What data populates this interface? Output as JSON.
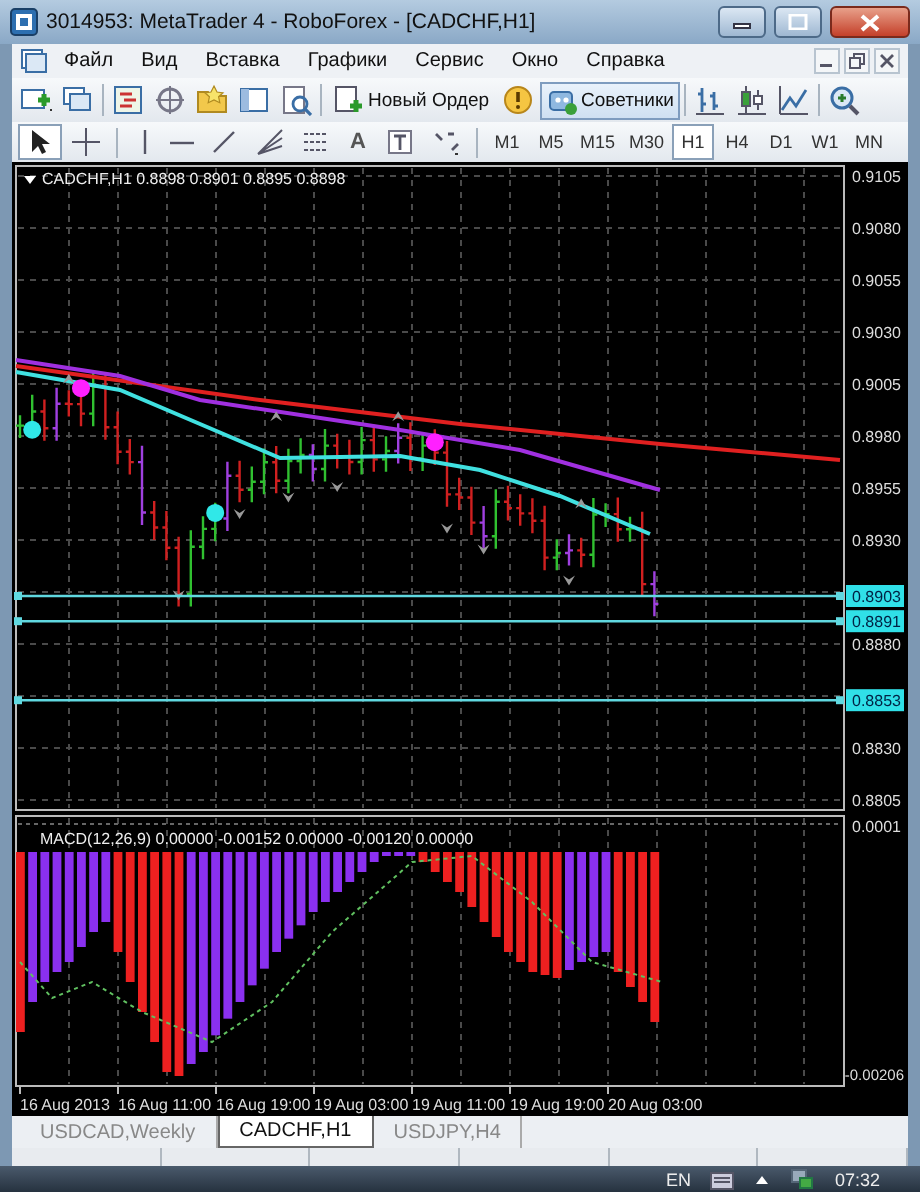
{
  "window": {
    "title": "3014953: MetaTrader 4 - RoboForex - [CADCHF,H1]"
  },
  "menu": [
    "Файл",
    "Вид",
    "Вставка",
    "Графики",
    "Сервис",
    "Окно",
    "Справка"
  ],
  "toolbar": {
    "new_order": "Новый Ордер",
    "experts": {
      "label": "Советники",
      "pressed": true
    }
  },
  "drawing_tools": [
    {
      "kind": "cursor",
      "selected": true
    },
    {
      "kind": "crosshair",
      "selected": false
    },
    {
      "kind": "vertical_line",
      "selected": false
    },
    {
      "kind": "horizontal_line",
      "selected": false
    },
    {
      "kind": "trend_line",
      "selected": false
    },
    {
      "kind": "fibonacci",
      "selected": false
    },
    {
      "kind": "channel",
      "selected": false
    },
    {
      "kind": "text",
      "glyph": "A",
      "selected": false
    },
    {
      "kind": "label",
      "selected": false
    },
    {
      "kind": "arrows",
      "selected": false
    }
  ],
  "timeframes": [
    {
      "label": "M1",
      "selected": false
    },
    {
      "label": "M5",
      "selected": false
    },
    {
      "label": "M15",
      "selected": false
    },
    {
      "label": "M30",
      "selected": false
    },
    {
      "label": "H1",
      "selected": true
    },
    {
      "label": "H4",
      "selected": false
    },
    {
      "label": "D1",
      "selected": false
    },
    {
      "label": "W1",
      "selected": false
    },
    {
      "label": "MN",
      "selected": false
    }
  ],
  "chart": {
    "header": "CADCHF,H1  0.8898 0.8901 0.8895 0.8898",
    "price_scale": [
      "0.9105",
      "0.9080",
      "0.9055",
      "0.9030",
      "0.9005",
      "0.8980",
      "0.8955",
      "0.8930",
      "0.8880",
      "0.8830",
      "0.8805"
    ],
    "price_lines": [
      {
        "label": "0.8903"
      },
      {
        "label": "0.8891"
      },
      {
        "label": "0.8853"
      }
    ],
    "indicator": {
      "header": "MACD(12,26,9) 0.00000 -0.00152 0.00000 -0.00120 0.00000",
      "scale": [
        "0.0001",
        "-0.00206"
      ]
    },
    "time_axis": [
      "16 Aug 2013",
      "16 Aug 11:00",
      "16 Aug 19:00",
      "19 Aug 03:00",
      "19 Aug 11:00",
      "19 Aug 19:00",
      "20 Aug 03:00"
    ]
  },
  "tabs": [
    {
      "label": "USDCAD,Weekly",
      "selected": false
    },
    {
      "label": "CADCHF,H1",
      "selected": true
    },
    {
      "label": "USDJPY,H4",
      "selected": false
    }
  ],
  "taskbar": {
    "language": "EN",
    "clock": "07:32"
  }
}
